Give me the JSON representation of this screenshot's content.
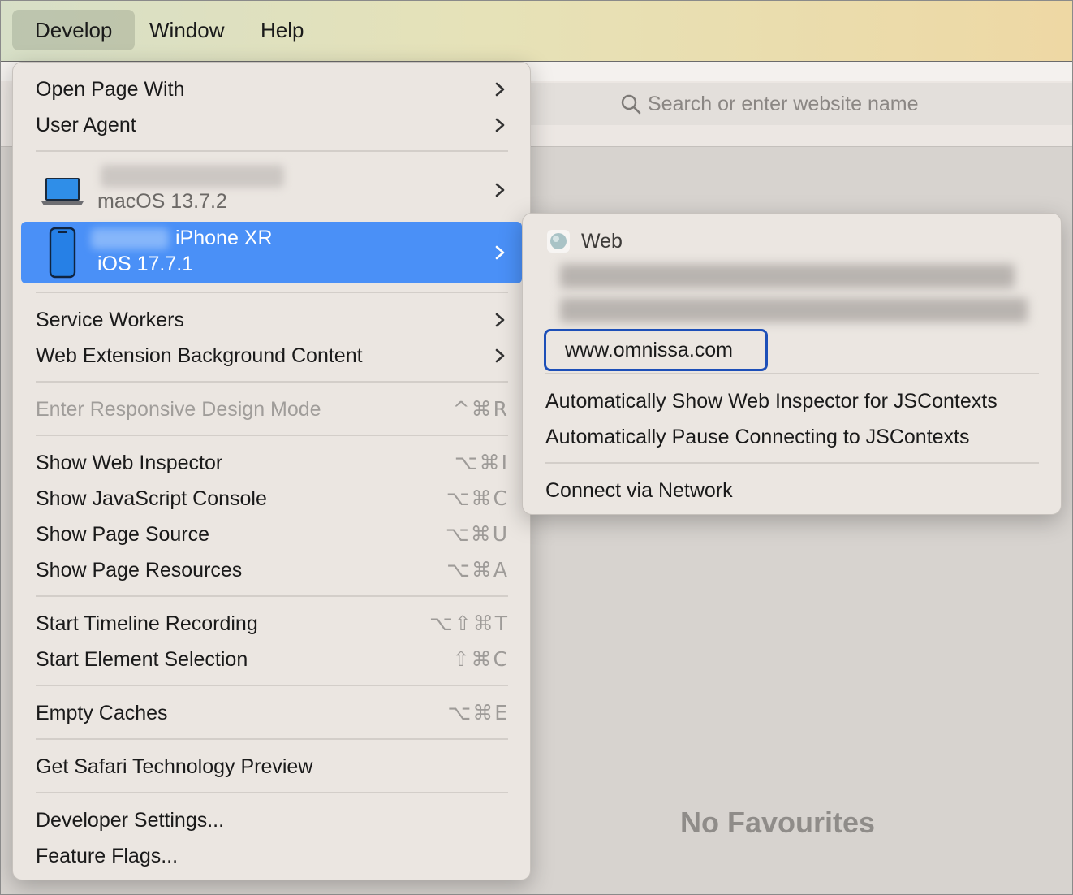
{
  "menubar": {
    "items": [
      "Develop",
      "Window",
      "Help"
    ]
  },
  "safari": {
    "search_placeholder": "Search or enter website name",
    "no_favourites": "No Favourites"
  },
  "develop_menu": {
    "open_page_with": "Open Page With",
    "user_agent": "User Agent",
    "mac_device_os": "macOS 13.7.2",
    "iphone_name": "iPhone XR",
    "iphone_os": "iOS 17.7.1",
    "service_workers": "Service Workers",
    "web_extension": "Web Extension Background Content",
    "responsive": {
      "label": "Enter Responsive Design Mode",
      "shortcut": "^⌘R"
    },
    "web_inspector": {
      "label": "Show Web Inspector",
      "shortcut": "⌥⌘I"
    },
    "js_console": {
      "label": "Show JavaScript Console",
      "shortcut": "⌥⌘C"
    },
    "page_source": {
      "label": "Show Page Source",
      "shortcut": "⌥⌘U"
    },
    "page_resources": {
      "label": "Show Page Resources",
      "shortcut": "⌥⌘A"
    },
    "timeline": {
      "label": "Start Timeline Recording",
      "shortcut": "⌥⇧⌘T"
    },
    "element_selection": {
      "label": "Start Element Selection",
      "shortcut": "⇧⌘C"
    },
    "empty_caches": {
      "label": "Empty Caches",
      "shortcut": "⌥⌘E"
    },
    "technology_preview": "Get Safari Technology Preview",
    "developer_settings": "Developer Settings...",
    "feature_flags": "Feature Flags..."
  },
  "device_submenu": {
    "web_label": "Web",
    "url": "www.omnissa.com",
    "auto_show_inspector": "Automatically Show Web Inspector for JSContexts",
    "auto_pause": "Automatically Pause Connecting to JSContexts",
    "connect_network": "Connect via Network"
  },
  "colors": {
    "highlight": "#4a90f7",
    "url_focus": "#1d4fb8"
  }
}
